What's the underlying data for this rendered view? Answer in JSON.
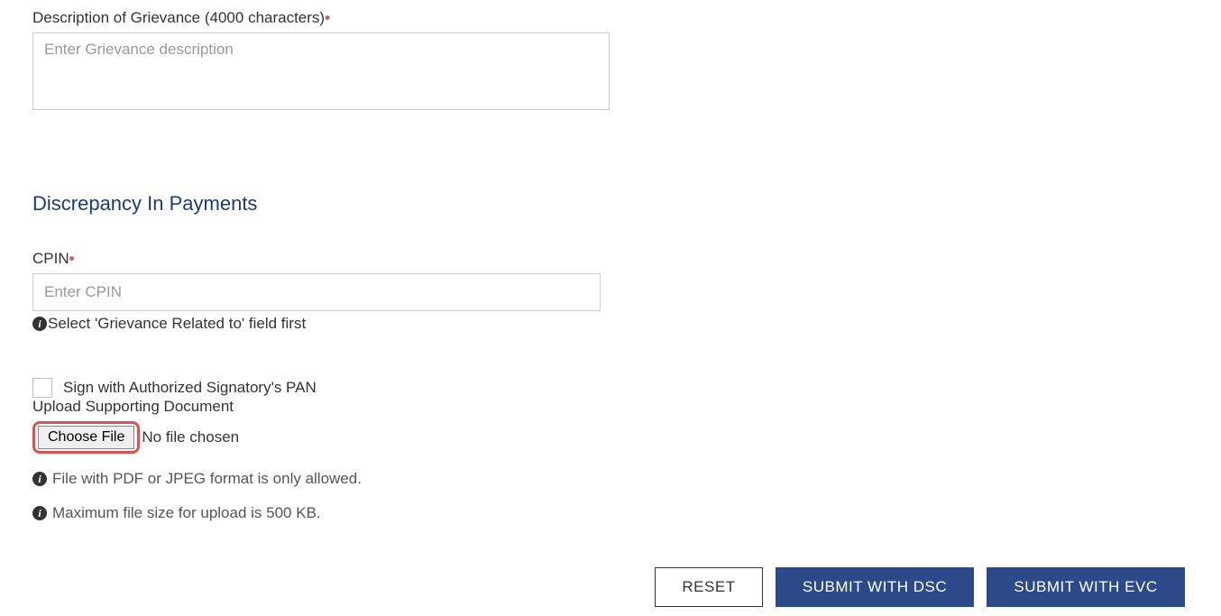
{
  "grievance": {
    "desc_label": "Description of Grievance (4000 characters)",
    "desc_placeholder": "Enter Grievance description"
  },
  "upload": {
    "label": "Upload Supporting Document",
    "choose_btn": "Choose File",
    "no_file": "No file chosen",
    "hint_format": "File with PDF or JPEG format is only allowed.",
    "hint_size": "Maximum file size for upload is 500 KB."
  },
  "discrepancy": {
    "heading": "Discrepancy In Payments",
    "cpin_label": "CPIN",
    "cpin_placeholder": "Enter CPIN",
    "helper": "Select 'Grievance Related to' field first"
  },
  "signature": {
    "checkbox_label": "Sign with Authorized Signatory's PAN"
  },
  "buttons": {
    "reset": "RESET",
    "submit_dsc": "SUBMIT WITH DSC",
    "submit_evc": "SUBMIT WITH EVC"
  }
}
